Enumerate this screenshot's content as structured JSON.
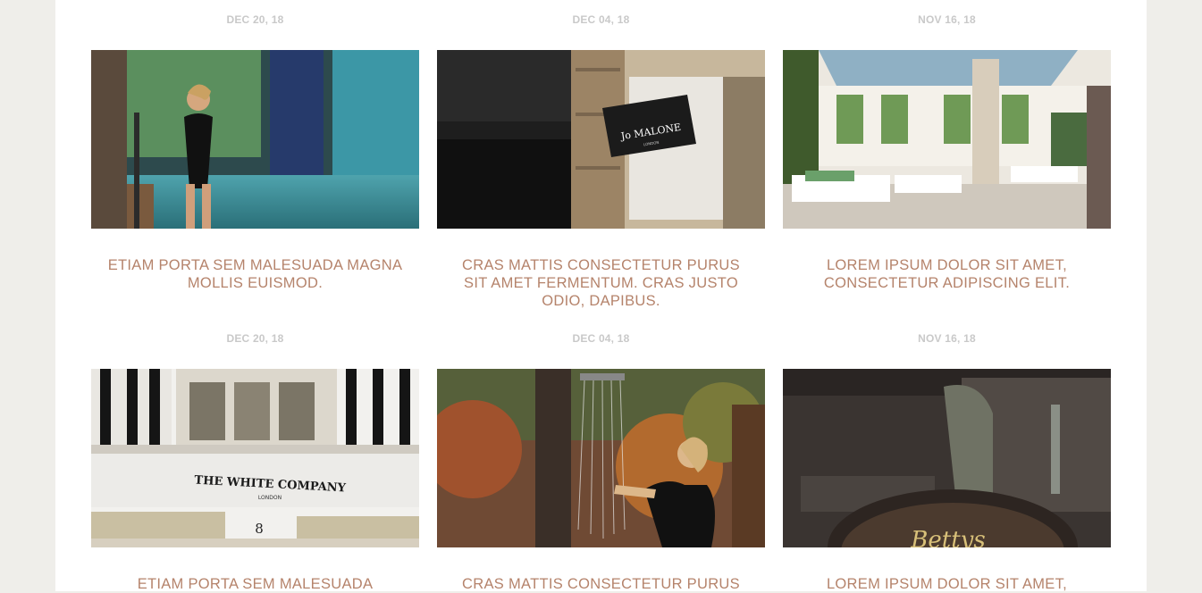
{
  "posts": [
    {
      "date": "DEC 20, 18",
      "title": "ETIAM PORTA SEM MALESUADA MAGNA MOLLIS EUISMOD.",
      "image": "woman-in-indoor-pool"
    },
    {
      "date": "DEC 04, 18",
      "title": "CRAS MATTIS CONSECTETUR PURUS SIT AMET FERMENTUM. CRAS JUSTO ODIO, DAPIBUS.",
      "image": "jo-malone-shop-sign",
      "sign_text": "Jo MALONE",
      "sign_subtext": "LONDON"
    },
    {
      "date": "NOV 16, 18",
      "title": "LOREM IPSUM DOLOR SIT AMET, CONSECTETUR ADIPISCING ELIT.",
      "image": "conservatory-lounge-loungers"
    },
    {
      "date": "DEC 20, 18",
      "title": "ETIAM PORTA SEM MALESUADA",
      "image": "white-company-storefront",
      "sign_text": "THE WHITE COMPANY",
      "sign_subtext": "LONDON",
      "door_number": "8"
    },
    {
      "date": "DEC 04, 18",
      "title": "CRAS MATTIS CONSECTETUR PURUS",
      "image": "woman-outdoor-shower-autumn"
    },
    {
      "date": "NOV 16, 18",
      "title": "LOREM IPSUM DOLOR SIT AMET,",
      "image": "bettys-marble-tray",
      "sign_text": "Bettys"
    }
  ],
  "colors": {
    "background": "#efeeea",
    "page": "#ffffff",
    "date": "#c9c9c9",
    "title": "#b5836b"
  }
}
